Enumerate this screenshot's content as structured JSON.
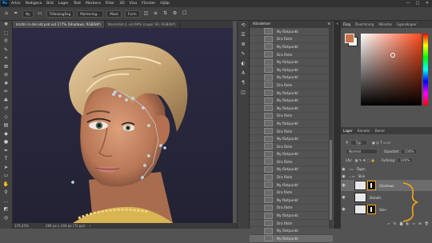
{
  "menubar": {
    "logo": "Ps",
    "items": [
      "Arkiv",
      "Redigera",
      "Bild",
      "Lager",
      "Text",
      "Markera",
      "Filter",
      "3D",
      "Visa",
      "Fönster",
      "Hjälp"
    ],
    "window_controls": [
      "—",
      "□",
      "✕"
    ]
  },
  "options_bar": {
    "mode_label": "Ny",
    "blend_label": "Tillbakagång",
    "marking_label": "Markering...",
    "mask_label": "Mask",
    "form_label": "Form"
  },
  "document_tabs": [
    "kristin in del old.psd vid 177% (Shadows, RGB/8#)",
    "Namnlöst-1 vid 69% (Lager 93, RGB/8#)"
  ],
  "status_bar": {
    "zoom": "176,35%",
    "doc_size": "266 px x 344 px (72 ppi)"
  },
  "history_panel": {
    "title": "Händelser",
    "items": [
      "Ny fästpunkt",
      "Dra fäste",
      "Ny fästpunkt",
      "Dra fäste",
      "Ny fästpunkt",
      "Ny fästpunkt",
      "Ny fästpunkt",
      "Dra fäste",
      "Ny fästpunkt",
      "Ny fästpunkt",
      "Ny fästpunkt",
      "Dra fäste",
      "Ny fästpunkt",
      "Dra fäste",
      "Ny fästpunkt",
      "Dra fäste",
      "Ny fästpunkt",
      "Dra fäste",
      "Ny fästpunkt",
      "Dra fäste",
      "Ny fästpunkt",
      "Dra fäste",
      "Ny fästpunkt",
      "Dra fäste",
      "Ny fästpunkt",
      "Dra fäste",
      "Ny fästpunkt",
      "Ny fästpunkt"
    ],
    "selected_index": 27
  },
  "color_panel": {
    "tabs": [
      "Färg",
      "Övertoning",
      "Mönster",
      "Egenskaper"
    ],
    "foreground": "#c8734a",
    "background": "#ffffff"
  },
  "layers_panel": {
    "tabs": [
      "Lager",
      "Kanaler",
      "Banor"
    ],
    "filter_label": "Typ",
    "blend_mode": "Normal",
    "opacity_label": "Opacitet:",
    "opacity_value": "100%",
    "lock_label": "Lås:",
    "fill_label": "Fyllning:",
    "fill_value": "100%",
    "layers": [
      {
        "name": "Ögon",
        "type": "group"
      },
      {
        "name": "Skin",
        "type": "group"
      },
      {
        "name": "Shadows",
        "type": "mask-layer"
      },
      {
        "name": "Details",
        "type": "layer"
      },
      {
        "name": "Skin",
        "type": "mask-layer"
      }
    ]
  },
  "colors": {
    "accent_orange": "#f7a21b",
    "anchor_blue": "#9fd7ff"
  }
}
